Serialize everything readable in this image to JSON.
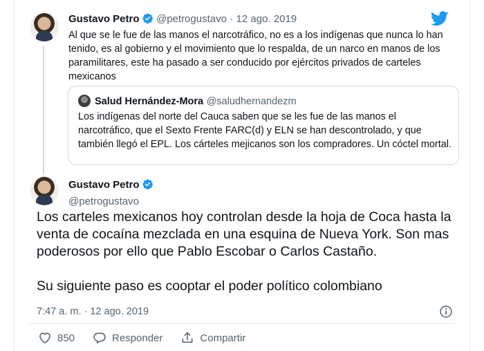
{
  "tweet1": {
    "author_name": "Gustavo Petro",
    "handle": "@petrogustavo",
    "date": "· 12 ago. 2019",
    "text": "Al que se le fue de las manos el narcotráfico, no es a los indígenas que nunca lo han tenido, es al gobierno y el movimiento que lo respalda, de un narco en manos de los paramilitares, este ha pasado a ser conducido por ejércitos privados de carteles mexicanos"
  },
  "quoted": {
    "author_name": "Salud Hernández-Mora",
    "handle": "@saludhernandezm",
    "text": "Los indígenas del norte del Cauca saben que se les fue de las manos el narcotráfico, que el Sexto Frente FARC(d) y ELN se han descontrolado, y que también llegó el EPL. Los cárteles mejicanos son los compradores. Un cóctel mortal."
  },
  "tweet2": {
    "author_name": "Gustavo Petro",
    "handle": "@petrogustavo",
    "paragraph1": "Los carteles mexicanos hoy controlan desde la hoja de Coca hasta la venta de cocaína mezclada en una esquina de Nueva York. Son mas poderosos por ello que Pablo Escobar o Carlos Castaño.",
    "paragraph2": "Su siguiente paso es cooptar el poder político colombiano",
    "timestamp": "7:47 a. m. · 12 ago. 2019"
  },
  "actions": {
    "likes": "850",
    "reply_label": "Responder",
    "share_label": "Compartir"
  },
  "icons": {
    "brand": "twitter-bird-icon",
    "verified": "verified-badge-icon",
    "info": "info-icon",
    "like": "heart-icon",
    "reply": "reply-icon",
    "share": "share-icon"
  },
  "colors": {
    "brand_blue": "#1d9bf0",
    "text": "#0f1419",
    "muted": "#536471"
  }
}
